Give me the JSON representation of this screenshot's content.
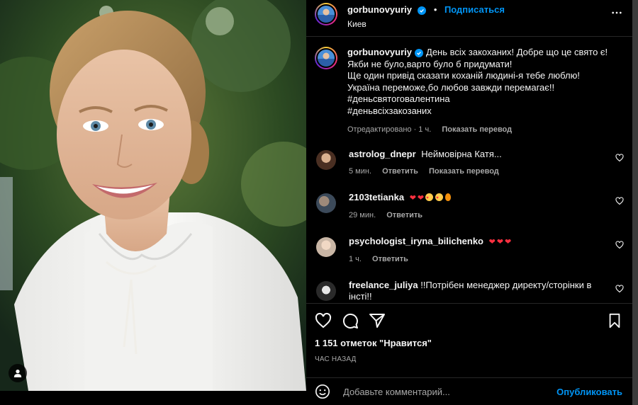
{
  "post": {
    "author": "gorbunovyuriy",
    "follow_label": "Подписаться",
    "separator": "•",
    "location": "Киев",
    "caption_lines": [
      "День всіх закоханих! Добре що це свято є!",
      "Якби не було,варто було б придумати!",
      "Ще один привід сказати коханій людині-я тебе люблю!",
      "Україна переможе,бо любов завжди перемагає!!",
      "#деньсвятоговалентина",
      "#деньвсіхзакозаних"
    ],
    "caption_edited": "Отредактировано · 1 ч.",
    "caption_translate": "Показать перевод",
    "likes": "1 151 отметок \"Нравится\"",
    "time_ago": "ЧАС НАЗАД",
    "comment_placeholder": "Добавьте комментарий...",
    "publish_label": "Опубликовать"
  },
  "comments": [
    {
      "user": "astrolog_dnepr",
      "text": "Неймовірна Катя...",
      "time": "5 мин.",
      "reply": "Ответить",
      "translate": "Показать перевод"
    },
    {
      "user": "2103tetianka",
      "text": "",
      "time": "29 мин.",
      "reply": "Ответить",
      "emoji": [
        "red-heart",
        "red-heart",
        "heart-eyes",
        "heart-eyes",
        "fire"
      ]
    },
    {
      "user": "psychologist_iryna_bilichenko",
      "text": "",
      "time": "1 ч.",
      "reply": "Ответить",
      "emoji": [
        "red-heart",
        "red-heart",
        "red-heart"
      ]
    },
    {
      "user": "freelance_juliya",
      "text": "!!Потрібен менеджер директу/сторінки в інсті!!"
    }
  ],
  "colors": {
    "accent": "#0095f6",
    "heart": "#ff3040",
    "muted": "#a8a8a8"
  },
  "icons": [
    "more-icon",
    "heart-icon",
    "comment-icon",
    "share-icon",
    "bookmark-icon",
    "emoji-icon",
    "user-tag-icon",
    "verified-icon"
  ]
}
